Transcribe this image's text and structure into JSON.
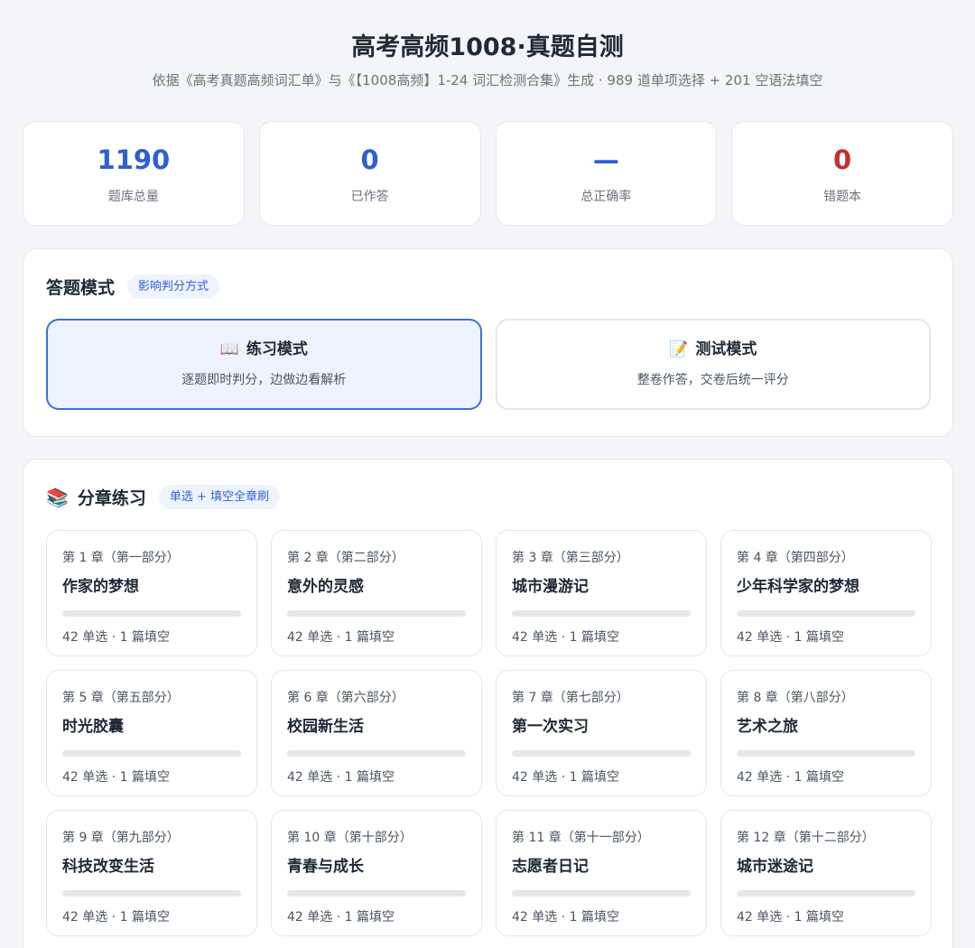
{
  "header": {
    "title": "高考高频1008·真题自测",
    "subtitle": "依据《高考真题高频词汇单》与《【1008高频】1-24 词汇检测合集》生成 · 989 道单项选择 + 201 空语法填空"
  },
  "stats": [
    {
      "value": "1190",
      "label": "题库总量",
      "color": "#2f5fd0"
    },
    {
      "value": "0",
      "label": "已作答",
      "color": "#2f5fd0"
    },
    {
      "value": "—",
      "label": "总正确率",
      "color": "#2f5fd0"
    },
    {
      "value": "0",
      "label": "错题本",
      "color": "#c62f2f"
    }
  ],
  "mode": {
    "title": "答题模式",
    "tag": "影响判分方式",
    "options": [
      {
        "emoji": "📖",
        "title": "练习模式",
        "desc": "逐题即时判分，边做边看解析",
        "active": true
      },
      {
        "emoji": "📝",
        "title": "测试模式",
        "desc": "整卷作答，交卷后统一评分",
        "active": false
      }
    ]
  },
  "chapters": {
    "icon": "📚",
    "title": "分章练习",
    "tag": "单选 + 填空全章刷",
    "items": [
      {
        "num": "第 1 章（第一部分）",
        "name": "作家的梦想",
        "meta": "42 单选 · 1 篇填空",
        "progress": 0
      },
      {
        "num": "第 2 章（第二部分）",
        "name": "意外的灵感",
        "meta": "42 单选 · 1 篇填空",
        "progress": 0
      },
      {
        "num": "第 3 章（第三部分）",
        "name": "城市漫游记",
        "meta": "42 单选 · 1 篇填空",
        "progress": 0
      },
      {
        "num": "第 4 章（第四部分）",
        "name": "少年科学家的梦想",
        "meta": "42 单选 · 1 篇填空",
        "progress": 0
      },
      {
        "num": "第 5 章（第五部分）",
        "name": "时光胶囊",
        "meta": "42 单选 · 1 篇填空",
        "progress": 0
      },
      {
        "num": "第 6 章（第六部分）",
        "name": "校园新生活",
        "meta": "42 单选 · 1 篇填空",
        "progress": 0
      },
      {
        "num": "第 7 章（第七部分）",
        "name": "第一次实习",
        "meta": "42 单选 · 1 篇填空",
        "progress": 0
      },
      {
        "num": "第 8 章（第八部分）",
        "name": "艺术之旅",
        "meta": "42 单选 · 1 篇填空",
        "progress": 0
      },
      {
        "num": "第 9 章（第九部分）",
        "name": "科技改变生活",
        "meta": "42 单选 · 1 篇填空",
        "progress": 0
      },
      {
        "num": "第 10 章（第十部分）",
        "name": "青春与成长",
        "meta": "42 单选 · 1 篇填空",
        "progress": 0
      },
      {
        "num": "第 11 章（第十一部分）",
        "name": "志愿者日记",
        "meta": "42 单选 · 1 篇填空",
        "progress": 0
      },
      {
        "num": "第 12 章（第十二部分）",
        "name": "城市迷途记",
        "meta": "42 单选 · 1 篇填空",
        "progress": 0
      }
    ]
  }
}
